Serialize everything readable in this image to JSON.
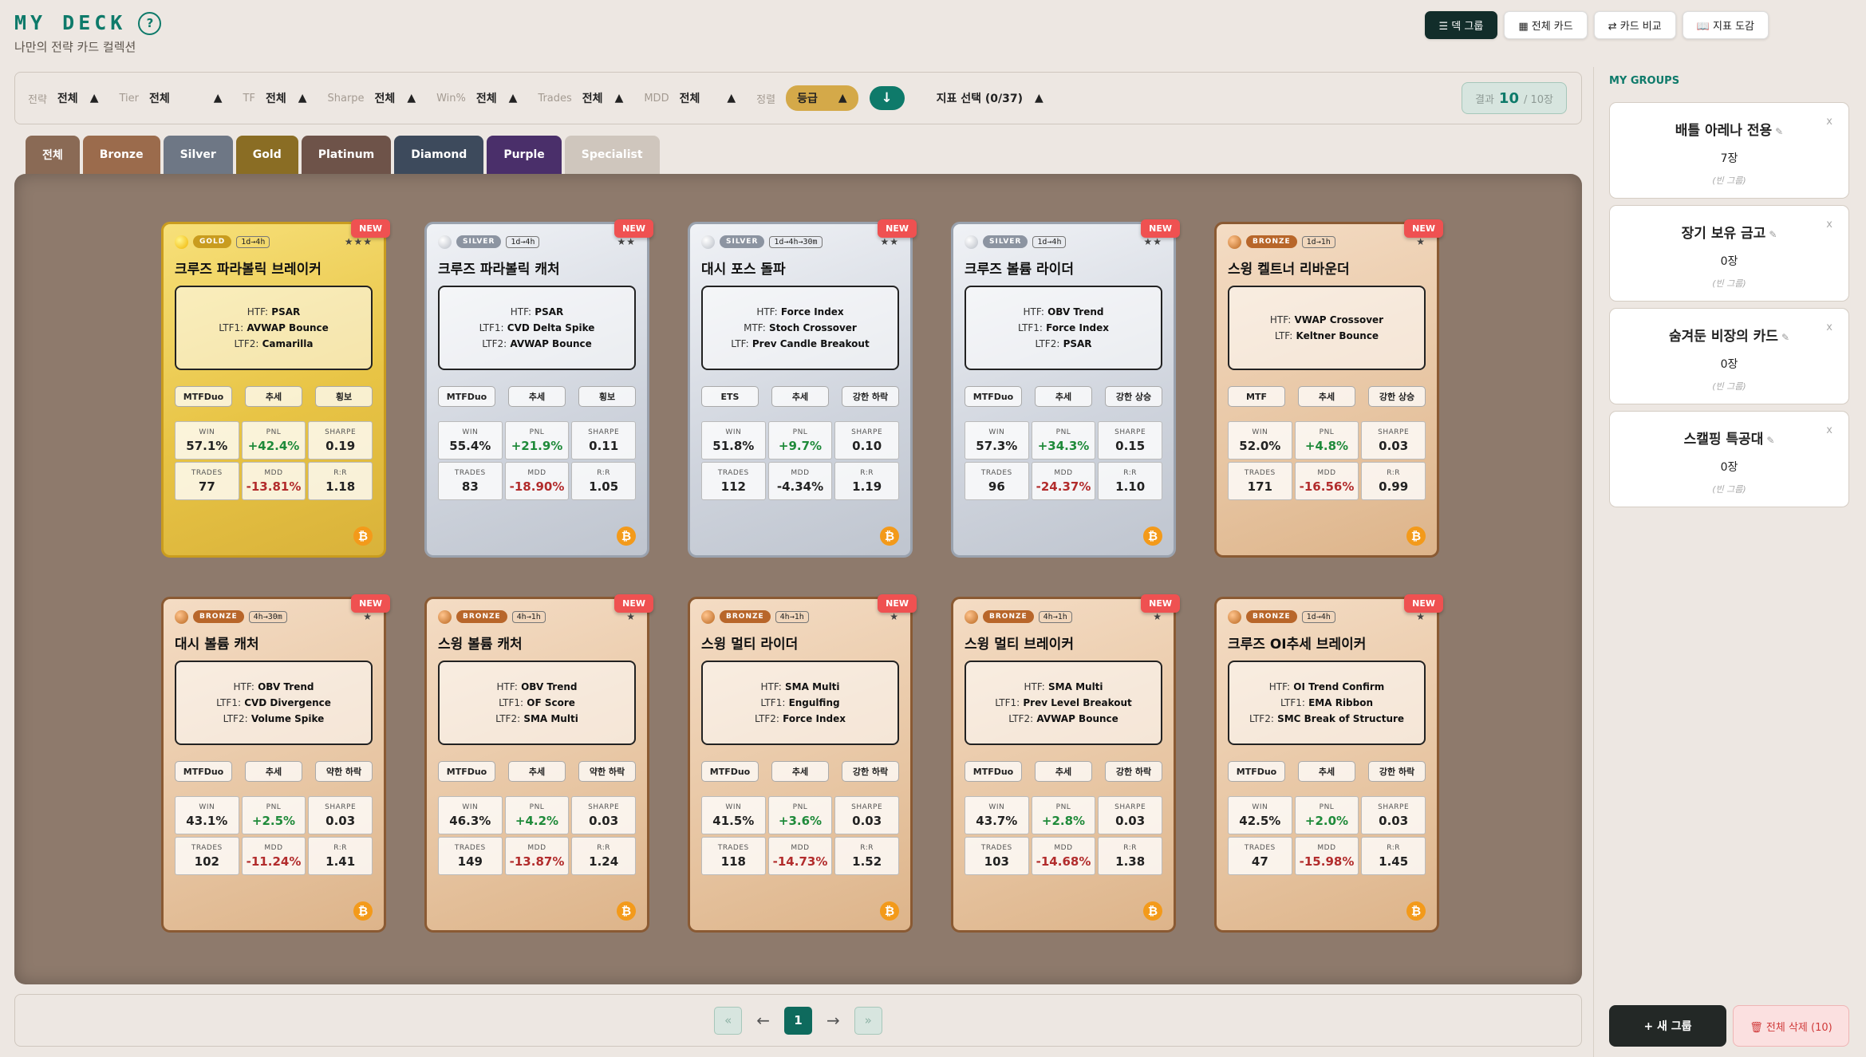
{
  "header": {
    "title": "MY DECK",
    "help_icon": "?",
    "subtitle": "나만의 전략 카드 컬렉션"
  },
  "top_buttons": [
    "☰ 덱 그룹",
    "▦ 전체 카드",
    "⇄ 카드 비교",
    "📖 지표 도감"
  ],
  "filters": [
    {
      "label": "전략",
      "value": "전체"
    },
    {
      "label": "Tier",
      "value": "전체"
    },
    {
      "label": "TF",
      "value": "전체"
    },
    {
      "label": "Sharpe",
      "value": "전체"
    },
    {
      "label": "Win%",
      "value": "전체"
    },
    {
      "label": "Trades",
      "value": "전체"
    },
    {
      "label": "MDD",
      "value": "전체"
    }
  ],
  "sort": {
    "label": "정렬",
    "value": "등급",
    "direction_icon": "↓"
  },
  "indicator_select": "지표 선택 (0/37)",
  "result": {
    "label": "결과",
    "count": "10",
    "total": "/ 10장"
  },
  "tabs": [
    {
      "label": "전체",
      "color": "#8a6a55"
    },
    {
      "label": "Bronze",
      "color": "#9b6b4c"
    },
    {
      "label": "Silver",
      "color": "#6e7785"
    },
    {
      "label": "Gold",
      "color": "#8a6d24"
    },
    {
      "label": "Platinum",
      "color": "#6e5349"
    },
    {
      "label": "Diamond",
      "color": "#3d4a5c"
    },
    {
      "label": "Purple",
      "color": "#4a2f6a"
    },
    {
      "label": "Specialist",
      "color": "#cfc6bd"
    }
  ],
  "cards": [
    {
      "tier": "GOLD",
      "tf": "1d→4h",
      "stars": "★★★",
      "name": "크루즈 파라볼릭 브레이커",
      "lines": [
        [
          "HTF:",
          "PSAR"
        ],
        [
          "LTF1:",
          "AVWAP Bounce"
        ],
        [
          "LTF2:",
          "Camarilla"
        ]
      ],
      "tags": [
        "MTFDuo",
        "추세",
        "횡보"
      ],
      "win": "57.1%",
      "pnl": "+42.4%",
      "sharpe": "0.19",
      "trades": "77",
      "mdd": "-13.81%",
      "rr": "1.18"
    },
    {
      "tier": "SILVER",
      "tf": "1d→4h",
      "stars": "★★",
      "name": "크루즈 파라볼릭 캐처",
      "lines": [
        [
          "HTF:",
          "PSAR"
        ],
        [
          "LTF1:",
          "CVD Delta Spike"
        ],
        [
          "LTF2:",
          "AVWAP Bounce"
        ]
      ],
      "tags": [
        "MTFDuo",
        "추세",
        "횡보"
      ],
      "win": "55.4%",
      "pnl": "+21.9%",
      "sharpe": "0.11",
      "trades": "83",
      "mdd": "-18.90%",
      "rr": "1.05"
    },
    {
      "tier": "SILVER",
      "tf": "1d→4h→30m",
      "stars": "★★",
      "name": "대시 포스 돌파",
      "lines": [
        [
          "HTF:",
          "Force Index"
        ],
        [
          "MTF:",
          "Stoch Crossover"
        ],
        [
          "LTF:",
          "Prev Candle Breakout"
        ]
      ],
      "tags": [
        "ETS",
        "추세",
        "강한 하락"
      ],
      "win": "51.8%",
      "pnl": "+9.7%",
      "sharpe": "0.10",
      "trades": "112",
      "mdd": "-4.34%",
      "rr": "1.19"
    },
    {
      "tier": "SILVER",
      "tf": "1d→4h",
      "stars": "★★",
      "name": "크루즈 볼륨 라이더",
      "lines": [
        [
          "HTF:",
          "OBV Trend"
        ],
        [
          "LTF1:",
          "Force Index"
        ],
        [
          "LTF2:",
          "PSAR"
        ]
      ],
      "tags": [
        "MTFDuo",
        "추세",
        "강한 상승"
      ],
      "win": "57.3%",
      "pnl": "+34.3%",
      "sharpe": "0.15",
      "trades": "96",
      "mdd": "-24.37%",
      "rr": "1.10"
    },
    {
      "tier": "BRONZE",
      "tf": "1d→1h",
      "stars": "★",
      "name": "스윙 켈트너 리바운더",
      "lines": [
        [
          "HTF:",
          "VWAP Crossover"
        ],
        [
          "LTF:",
          "Keltner Bounce"
        ]
      ],
      "tags": [
        "MTF",
        "추세",
        "강한 상승"
      ],
      "win": "52.0%",
      "pnl": "+4.8%",
      "sharpe": "0.03",
      "trades": "171",
      "mdd": "-16.56%",
      "rr": "0.99"
    },
    {
      "tier": "BRONZE",
      "tf": "4h→30m",
      "stars": "★",
      "name": "대시 볼륨 캐처",
      "lines": [
        [
          "HTF:",
          "OBV Trend"
        ],
        [
          "LTF1:",
          "CVD Divergence"
        ],
        [
          "LTF2:",
          "Volume Spike"
        ]
      ],
      "tags": [
        "MTFDuo",
        "추세",
        "약한 하락"
      ],
      "win": "43.1%",
      "pnl": "+2.5%",
      "sharpe": "0.03",
      "trades": "102",
      "mdd": "-11.24%",
      "rr": "1.41"
    },
    {
      "tier": "BRONZE",
      "tf": "4h→1h",
      "stars": "★",
      "name": "스윙 볼륨 캐처",
      "lines": [
        [
          "HTF:",
          "OBV Trend"
        ],
        [
          "LTF1:",
          "OF Score"
        ],
        [
          "LTF2:",
          "SMA Multi"
        ]
      ],
      "tags": [
        "MTFDuo",
        "추세",
        "약한 하락"
      ],
      "win": "46.3%",
      "pnl": "+4.2%",
      "sharpe": "0.03",
      "trades": "149",
      "mdd": "-13.87%",
      "rr": "1.24"
    },
    {
      "tier": "BRONZE",
      "tf": "4h→1h",
      "stars": "★",
      "name": "스윙 멀티 라이더",
      "lines": [
        [
          "HTF:",
          "SMA Multi"
        ],
        [
          "LTF1:",
          "Engulfing"
        ],
        [
          "LTF2:",
          "Force Index"
        ]
      ],
      "tags": [
        "MTFDuo",
        "추세",
        "강한 하락"
      ],
      "win": "41.5%",
      "pnl": "+3.6%",
      "sharpe": "0.03",
      "trades": "118",
      "mdd": "-14.73%",
      "rr": "1.52"
    },
    {
      "tier": "BRONZE",
      "tf": "4h→1h",
      "stars": "★",
      "name": "스윙 멀티 브레이커",
      "lines": [
        [
          "HTF:",
          "SMA Multi"
        ],
        [
          "LTF1:",
          "Prev Level Breakout"
        ],
        [
          "LTF2:",
          "AVWAP Bounce"
        ]
      ],
      "tags": [
        "MTFDuo",
        "추세",
        "강한 하락"
      ],
      "win": "43.7%",
      "pnl": "+2.8%",
      "sharpe": "0.03",
      "trades": "103",
      "mdd": "-14.68%",
      "rr": "1.38"
    },
    {
      "tier": "BRONZE",
      "tf": "1d→4h",
      "stars": "★",
      "name": "크루즈 OI추세 브레이커",
      "lines": [
        [
          "HTF:",
          "OI Trend Confirm"
        ],
        [
          "LTF1:",
          "EMA Ribbon"
        ],
        [
          "LTF2:",
          "SMC Break of Structure"
        ]
      ],
      "tags": [
        "MTFDuo",
        "추세",
        "강한 하락"
      ],
      "win": "42.5%",
      "pnl": "+2.0%",
      "sharpe": "0.03",
      "trades": "47",
      "mdd": "-15.98%",
      "rr": "1.45"
    }
  ],
  "card_labels": {
    "new": "NEW",
    "win": "WIN",
    "pnl": "PNL",
    "sharpe": "SHARPE",
    "trades": "TRADES",
    "mdd": "MDD",
    "rr": "R:R",
    "coin_icon": "₿"
  },
  "pager": {
    "first": "«",
    "prev": "←",
    "page": "1",
    "next": "→",
    "last": "»"
  },
  "sidebar": {
    "title": "MY GROUPS",
    "groups": [
      {
        "name": "배틀 아레나 전용",
        "count": "7장",
        "note": "(빈 그룹)"
      },
      {
        "name": "장기 보유 금고",
        "count": "0장",
        "note": "(빈 그룹)"
      },
      {
        "name": "숨겨둔 비장의 카드",
        "count": "0장",
        "note": "(빈 그룹)"
      },
      {
        "name": "스캘핑 특공대",
        "count": "0장",
        "note": "(빈 그룹)"
      }
    ],
    "edit_icon": "✎",
    "close_icon": "x",
    "new_group": "+ 새 그룹",
    "delete_all": "🗑 전체 삭제 (10)"
  }
}
